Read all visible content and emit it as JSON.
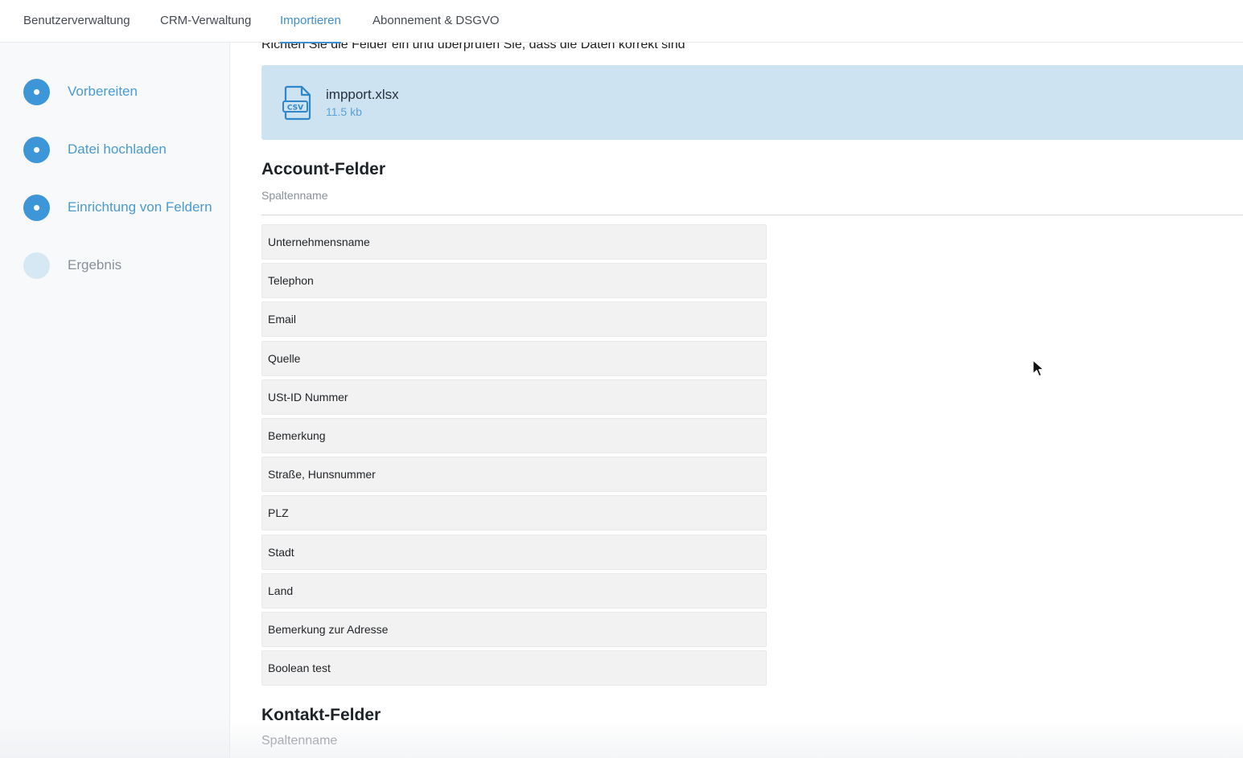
{
  "topbar": {
    "tabs": [
      {
        "label": "Benutzerverwaltung",
        "active": false
      },
      {
        "label": "CRM-Verwaltung",
        "active": false
      },
      {
        "label": "Importieren",
        "active": true
      },
      {
        "label": "Abonnement & DSGVO",
        "active": false
      }
    ]
  },
  "sidebar": {
    "steps": [
      {
        "label": "Vorbereiten",
        "state": "done"
      },
      {
        "label": "Datei hochladen",
        "state": "done"
      },
      {
        "label": "Einrichtung von Feldern",
        "state": "current"
      },
      {
        "label": "Ergebnis",
        "state": "pending"
      }
    ]
  },
  "main": {
    "intro": "Richten Sie die Felder ein und überprüfen Sie, dass die Daten korrekt sind",
    "file": {
      "icon": "csv-file-icon",
      "icon_text": "CSV",
      "name": "impport.xlsx",
      "size": "11.5 kb"
    },
    "account_section": {
      "title": "Account-Felder",
      "column_header": "Spaltenname",
      "fields": [
        "Unternehmensname",
        "Telephon",
        "Email",
        "Quelle",
        "USt-ID Nummer",
        "Bemerkung",
        "Straße, Hunsnummer",
        "PLZ",
        "Stadt",
        "Land",
        "Bemerkung zur Adresse",
        "Boolean test"
      ]
    },
    "contact_section": {
      "title": "Kontakt-Felder",
      "column_header": "Spaltenname"
    }
  },
  "colors": {
    "accent": "#3d8fd1",
    "step_active": "#3d96d8",
    "step_pending": "#d6e8f4",
    "file_card_bg": "#cde3f2",
    "field_bg": "#f2f2f2"
  }
}
